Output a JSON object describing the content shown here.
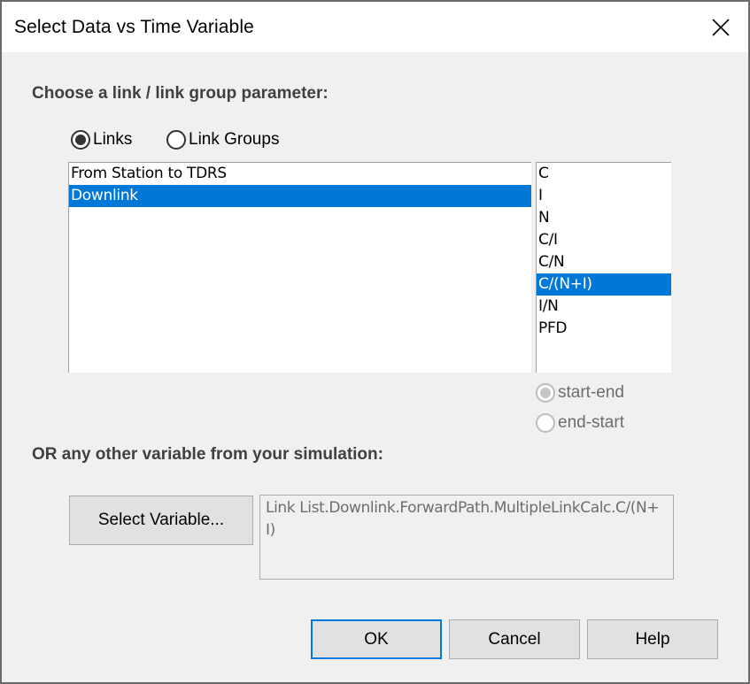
{
  "window": {
    "title": "Select Data vs Time Variable",
    "close_icon": "close-icon"
  },
  "link_section": {
    "label": "Choose a link / link group parameter:",
    "mode_options": [
      {
        "label": "Links",
        "selected": true
      },
      {
        "label": "Link Groups",
        "selected": false
      }
    ],
    "links_list": {
      "items": [
        "From Station to TDRS",
        "Downlink"
      ],
      "selected": "Downlink"
    },
    "parameter_list": {
      "items": [
        "C",
        "I",
        "N",
        "C/I",
        "C/N",
        "C/(N+I)",
        "I/N",
        "PFD"
      ],
      "selected": "C/(N+I)"
    },
    "direction_options": [
      {
        "label": "start-end",
        "selected": true,
        "enabled": false
      },
      {
        "label": "end-start",
        "selected": false,
        "enabled": false
      }
    ]
  },
  "variable_section": {
    "label": "OR any other variable from your simulation:",
    "select_button_label": "Select Variable...",
    "selected_variable": "Link List.Downlink.ForwardPath.MultipleLinkCalc.C/(N+I)"
  },
  "footer": {
    "ok_label": "OK",
    "cancel_label": "Cancel",
    "help_label": "Help"
  },
  "colors": {
    "selection": "#0078d7",
    "default_button_border": "#0078d7"
  }
}
